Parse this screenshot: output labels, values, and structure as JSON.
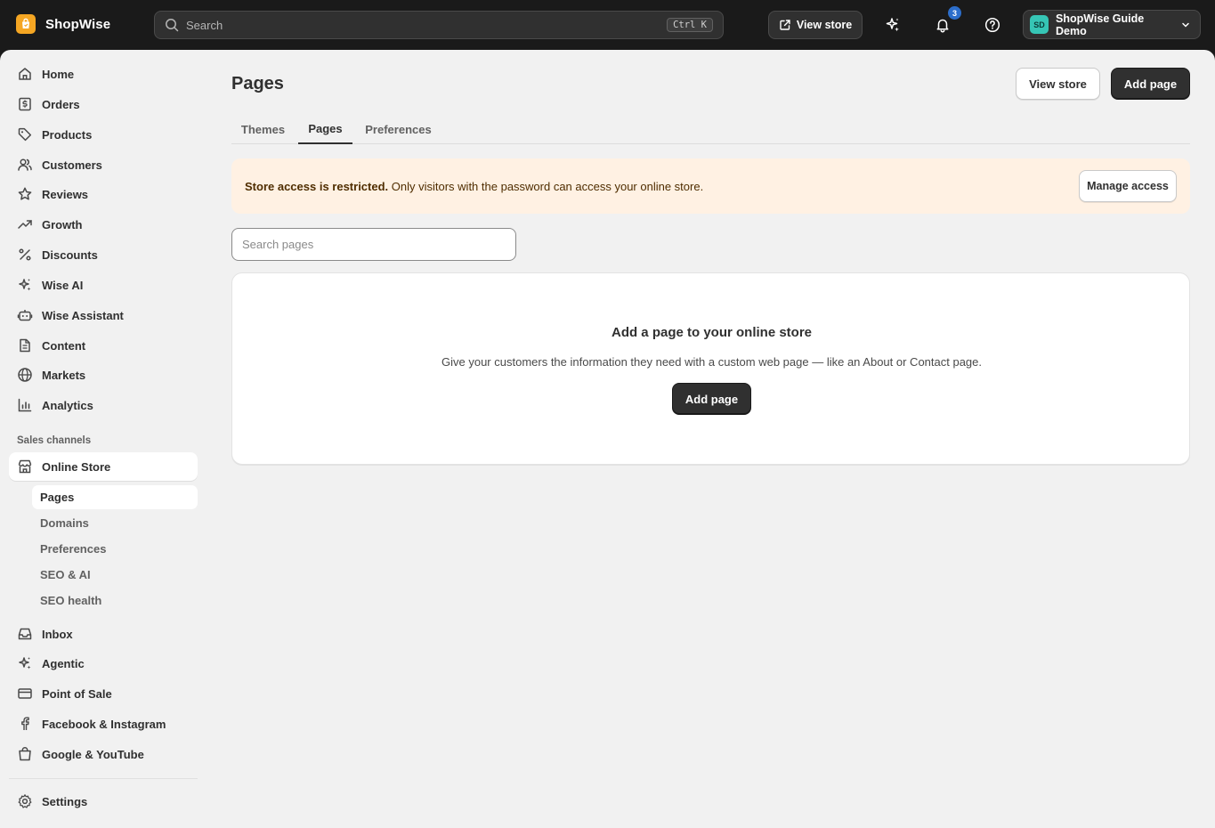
{
  "topbar": {
    "brand": "ShopWise",
    "search_placeholder": "Search",
    "search_shortcut": "Ctrl K",
    "view_store_label": "View store",
    "notification_count": "3",
    "account_initials": "SD",
    "account_name": "ShopWise Guide Demo"
  },
  "sidebar": {
    "items": [
      {
        "label": "Home",
        "icon": "home-icon"
      },
      {
        "label": "Orders",
        "icon": "orders-icon"
      },
      {
        "label": "Products",
        "icon": "tag-icon"
      },
      {
        "label": "Customers",
        "icon": "people-icon"
      },
      {
        "label": "Reviews",
        "icon": "star-icon"
      },
      {
        "label": "Growth",
        "icon": "trend-icon"
      },
      {
        "label": "Discounts",
        "icon": "percent-icon"
      },
      {
        "label": "Wise AI",
        "icon": "sparkle-icon"
      },
      {
        "label": "Wise Assistant",
        "icon": "robot-icon"
      },
      {
        "label": "Content",
        "icon": "document-icon"
      },
      {
        "label": "Markets",
        "icon": "globe-icon"
      },
      {
        "label": "Analytics",
        "icon": "chart-icon"
      }
    ],
    "sales_channels_label": "Sales channels",
    "online_store": {
      "label": "Online Store",
      "icon": "store-icon"
    },
    "online_store_sub": [
      "Pages",
      "Domains",
      "Preferences",
      "SEO & AI",
      "SEO health"
    ],
    "channels": [
      {
        "label": "Inbox",
        "icon": "inbox-icon"
      },
      {
        "label": "Agentic",
        "icon": "sparkle-icon"
      },
      {
        "label": "Point of Sale",
        "icon": "card-icon"
      },
      {
        "label": "Facebook & Instagram",
        "icon": "facebook-icon"
      },
      {
        "label": "Google & YouTube",
        "icon": "bag-icon"
      }
    ],
    "settings_label": "Settings"
  },
  "main": {
    "title": "Pages",
    "view_store_label": "View store",
    "add_page_label": "Add page",
    "tabs": [
      "Themes",
      "Pages",
      "Preferences"
    ],
    "active_tab": "Pages",
    "banner": {
      "bold": "Store access is restricted.",
      "text": " Only visitors with the password can access your online store.",
      "button": "Manage access"
    },
    "search_placeholder": "Search pages",
    "empty_state": {
      "title": "Add a page to your online store",
      "description": "Give your customers the information they need with a custom web page — like an About or Contact page.",
      "button": "Add page"
    }
  },
  "colors": {
    "topbar_bg": "#1a1a1a",
    "frame_bg": "#f1f1f1",
    "primary_button": "#303030",
    "banner_bg": "#fff1e3",
    "notification_badge": "#2c6ecb",
    "brand_logo": "#f5a623",
    "avatar": "#36c5b5"
  }
}
